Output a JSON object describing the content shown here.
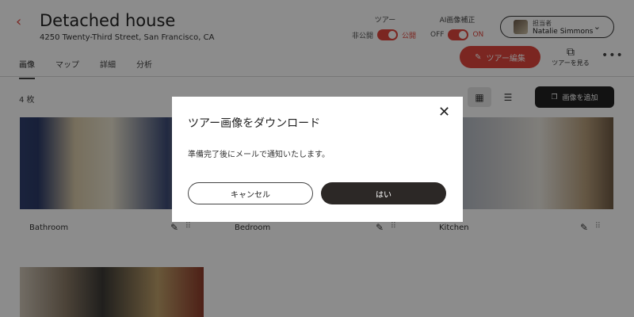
{
  "header": {
    "back_icon": "chevron-left-icon",
    "title": "Detached house",
    "address": "4250 Twenty-Third Street, San Francisco, CA",
    "tour_toggle": {
      "label": "ツアー",
      "off": "非公開",
      "on": "公開"
    },
    "ai_toggle": {
      "label": "AI画像補正",
      "off": "OFF",
      "on": "ON"
    },
    "owner": {
      "role": "担当者",
      "name": "Natalie Simmons"
    },
    "edit_tour_label": "ツアー編集",
    "view_tour_label": "ツアーを見る"
  },
  "tabs": [
    {
      "label": "画像"
    },
    {
      "label": "マップ"
    },
    {
      "label": "詳細"
    },
    {
      "label": "分析"
    }
  ],
  "toolbar": {
    "count": "4 枚",
    "add_label": "画像を追加"
  },
  "cards": [
    {
      "name": "Bathroom"
    },
    {
      "name": "Bedroom"
    },
    {
      "name": "Kitchen"
    },
    {
      "name": ""
    }
  ],
  "modal": {
    "title": "ツアー画像をダウンロード",
    "message": "準備完了後にメールで通知いたします。",
    "cancel_label": "キャンセル",
    "confirm_label": "はい"
  },
  "colors": {
    "accent": "#e0463c",
    "dark": "#2c2826",
    "overlay": "rgba(0,0,0,0.45)"
  }
}
